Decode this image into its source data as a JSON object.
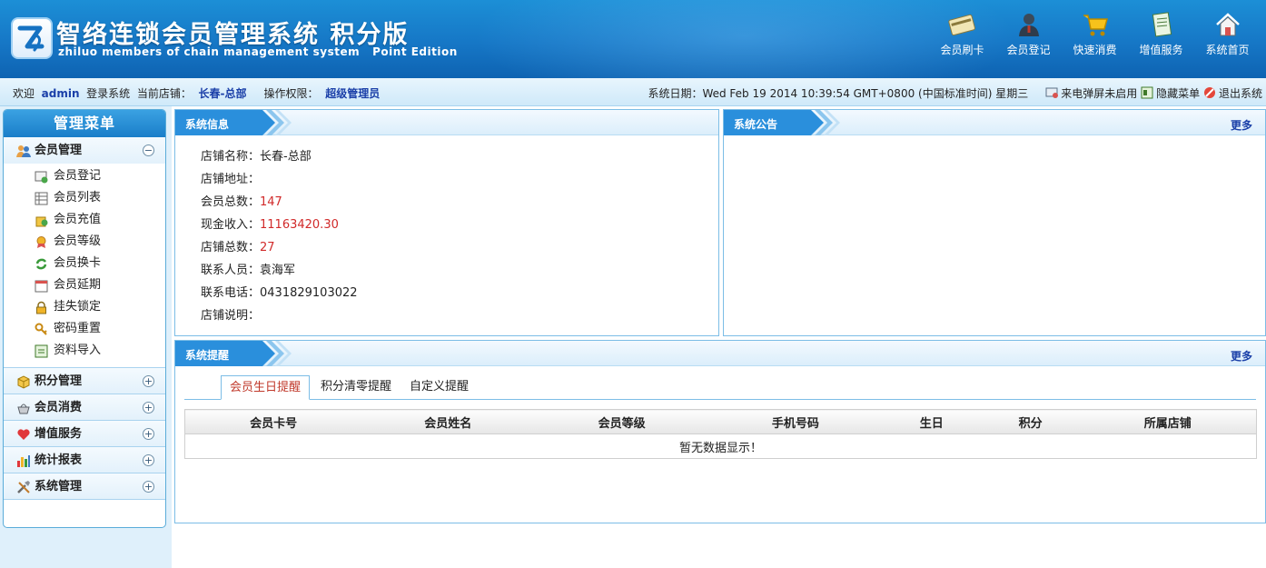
{
  "header": {
    "brand_cn": "智络连锁会员管理系统 积分版",
    "brand_en": "zhiluo members of chain management system",
    "brand_edition": "Point Edition",
    "logo_icon": "zl-logo-icon",
    "nav": [
      {
        "label": "会员刷卡",
        "icon": "card-icon"
      },
      {
        "label": "会员登记",
        "icon": "person-icon"
      },
      {
        "label": "快速消费",
        "icon": "cart-icon"
      },
      {
        "label": "增值服务",
        "icon": "document-icon"
      },
      {
        "label": "系统首页",
        "icon": "home-icon"
      }
    ]
  },
  "status": {
    "welcome": "欢迎",
    "user": "admin",
    "login_text": "登录系统",
    "store_label": "当前店铺：",
    "store": "长春-总部",
    "perm_label": "操作权限：",
    "perm": "超级管理员",
    "date_label": "系统日期：",
    "date_value": "Wed Feb 19 2014 10:39:54 GMT+0800 (中国标准时间) 星期三",
    "popup_label": "来电弹屏未启用",
    "hide_menu_label": "隐藏菜单",
    "logout_label": "退出系统"
  },
  "sidebar": {
    "title": "管理菜单",
    "member_group": {
      "label": "会员管理",
      "toggle": "⊖"
    },
    "member_items": [
      {
        "label": "会员登记",
        "icon": "register-icon"
      },
      {
        "label": "会员列表",
        "icon": "list-icon"
      },
      {
        "label": "会员充值",
        "icon": "recharge-icon"
      },
      {
        "label": "会员等级",
        "icon": "medal-icon"
      },
      {
        "label": "会员换卡",
        "icon": "swap-icon"
      },
      {
        "label": "会员延期",
        "icon": "calendar-icon"
      },
      {
        "label": "挂失锁定",
        "icon": "lock-icon"
      },
      {
        "label": "密码重置",
        "icon": "key-icon"
      },
      {
        "label": "资料导入",
        "icon": "import-icon"
      }
    ],
    "groups": [
      {
        "label": "积分管理",
        "icon": "box-icon",
        "toggle": "+"
      },
      {
        "label": "会员消费",
        "icon": "basket-icon",
        "toggle": "+"
      },
      {
        "label": "增值服务",
        "icon": "heart-icon",
        "toggle": "+"
      },
      {
        "label": "统计报表",
        "icon": "bar-chart-icon",
        "toggle": "+"
      },
      {
        "label": "系统管理",
        "icon": "tools-icon",
        "toggle": "+"
      }
    ]
  },
  "sysinfo": {
    "title": "系统信息",
    "rows": [
      {
        "label": "店铺名称：",
        "value": "长春-总部",
        "red": false
      },
      {
        "label": "店铺地址：",
        "value": "",
        "red": false
      },
      {
        "label": "会员总数：",
        "value": "147",
        "red": true
      },
      {
        "label": "现金收入：",
        "value": "11163420.30",
        "red": true
      },
      {
        "label": "店铺总数：",
        "value": "27",
        "red": true
      },
      {
        "label": "联系人员：",
        "value": "袁海军",
        "red": false
      },
      {
        "label": "联系电话：",
        "value": "0431829103022",
        "red": false
      },
      {
        "label": "店铺说明：",
        "value": "",
        "red": false
      }
    ]
  },
  "notice": {
    "title": "系统公告",
    "more": "更多"
  },
  "reminder": {
    "title": "系统提醒",
    "more": "更多",
    "tabs": [
      "会员生日提醒",
      "积分清零提醒",
      "自定义提醒"
    ],
    "columns": [
      "会员卡号",
      "会员姓名",
      "会员等级",
      "手机号码",
      "生日",
      "积分",
      "所属店铺"
    ],
    "empty": "暂无数据显示！"
  },
  "colors": {
    "accent": "#1a7ec9",
    "link": "#1a3fa8",
    "red": "#d12a2a"
  }
}
